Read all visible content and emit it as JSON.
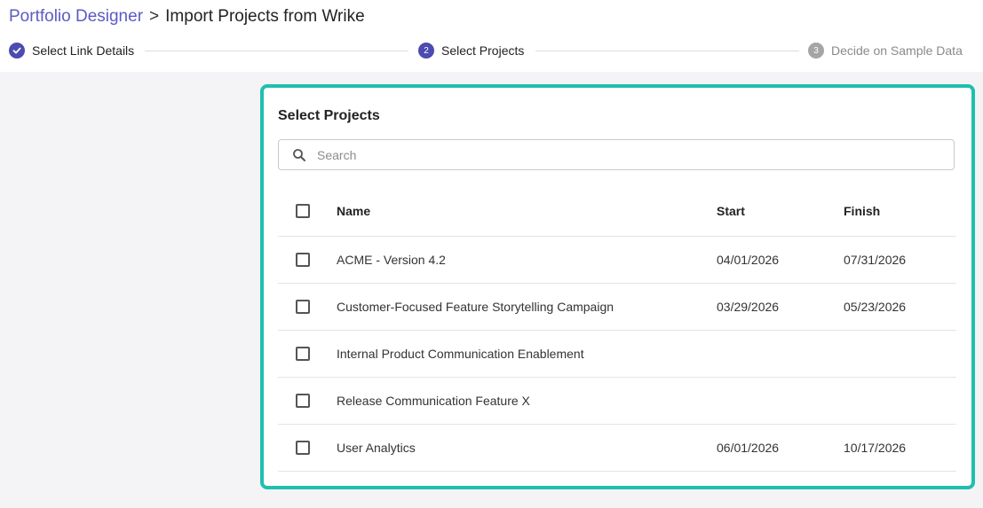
{
  "breadcrumb": {
    "parent": "Portfolio Designer",
    "separator": ">",
    "current": "Import Projects from Wrike"
  },
  "stepper": {
    "steps": [
      {
        "label": "Select Link Details",
        "number": "1",
        "state": "done"
      },
      {
        "label": "Select Projects",
        "number": "2",
        "state": "active"
      },
      {
        "label": "Decide on Sample Data",
        "number": "3",
        "state": "pending"
      }
    ]
  },
  "panel": {
    "title": "Select Projects",
    "search_placeholder": "Search",
    "columns": {
      "name": "Name",
      "start": "Start",
      "finish": "Finish"
    },
    "rows": [
      {
        "name": "ACME - Version 4.2",
        "start": "04/01/2026",
        "finish": "07/31/2026",
        "checked": false
      },
      {
        "name": "Customer-Focused Feature Storytelling Campaign",
        "start": "03/29/2026",
        "finish": "05/23/2026",
        "checked": false
      },
      {
        "name": "Internal Product Communication Enablement",
        "start": "",
        "finish": "",
        "checked": false
      },
      {
        "name": "Release Communication Feature X",
        "start": "",
        "finish": "",
        "checked": false
      },
      {
        "name": "User Analytics",
        "start": "06/01/2026",
        "finish": "10/17/2026",
        "checked": false
      }
    ]
  },
  "colors": {
    "accent": "#4b4bb0",
    "link": "#5b5bc4",
    "highlight_border": "#1fbfb0",
    "pending": "#a5a5a5"
  }
}
